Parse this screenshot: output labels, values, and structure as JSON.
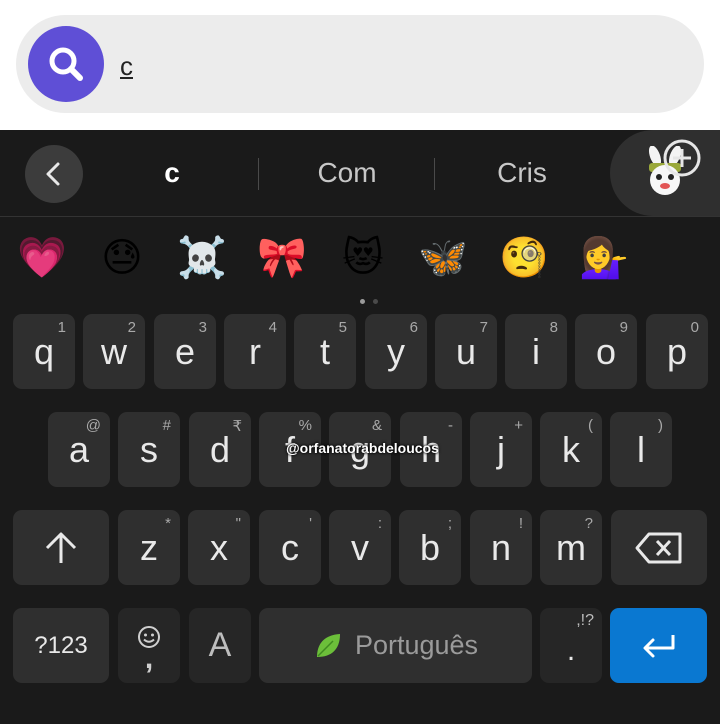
{
  "search": {
    "query": "c"
  },
  "suggestions": [
    "c",
    "Com",
    "Cris"
  ],
  "emojis": [
    {
      "name": "heart-icon",
      "glyph": "💗"
    },
    {
      "name": "sad-sweat-face-icon",
      "glyph": "😓"
    },
    {
      "name": "skull-crossbones-icon",
      "glyph": "☠️"
    },
    {
      "name": "ribbon-icon",
      "glyph": "🎀"
    },
    {
      "name": "heart-eyes-cat-icon",
      "glyph": "😻"
    },
    {
      "name": "butterfly-icon",
      "glyph": "🦋"
    },
    {
      "name": "monocle-face-icon",
      "glyph": "🧐"
    },
    {
      "name": "person-tipping-hand-icon",
      "glyph": "💁‍♀️"
    }
  ],
  "rows": [
    [
      [
        "q",
        "1"
      ],
      [
        "w",
        "2"
      ],
      [
        "e",
        "3"
      ],
      [
        "r",
        "4"
      ],
      [
        "t",
        "5"
      ],
      [
        "y",
        "6"
      ],
      [
        "u",
        "7"
      ],
      [
        "i",
        "8"
      ],
      [
        "o",
        "9"
      ],
      [
        "p",
        "0"
      ]
    ],
    [
      [
        "a",
        "@"
      ],
      [
        "s",
        "#"
      ],
      [
        "d",
        "₹"
      ],
      [
        "f",
        "%"
      ],
      [
        "g",
        "&"
      ],
      [
        "h",
        "-"
      ],
      [
        "j",
        "+"
      ],
      [
        "k",
        "("
      ],
      [
        "l",
        ")"
      ]
    ],
    [
      [
        "z",
        "*"
      ],
      [
        "x",
        "\""
      ],
      [
        "c",
        "'"
      ],
      [
        "v",
        ":"
      ],
      [
        "b",
        ";"
      ],
      [
        "n",
        "!"
      ],
      [
        "m",
        "?"
      ]
    ]
  ],
  "bottom": {
    "symbols_label": "?123",
    "emoji_key_sub": ",",
    "case_key": "A",
    "space_label": "Português",
    "period": ".",
    "period_sub": ",!?"
  },
  "watermark": "@orfanatorabdeloucos",
  "colors": {
    "accent": "#5f4fd6",
    "enter": "#0a78d1",
    "key": "#2f2f2f",
    "keyboard_bg": "#1a1a1a"
  }
}
